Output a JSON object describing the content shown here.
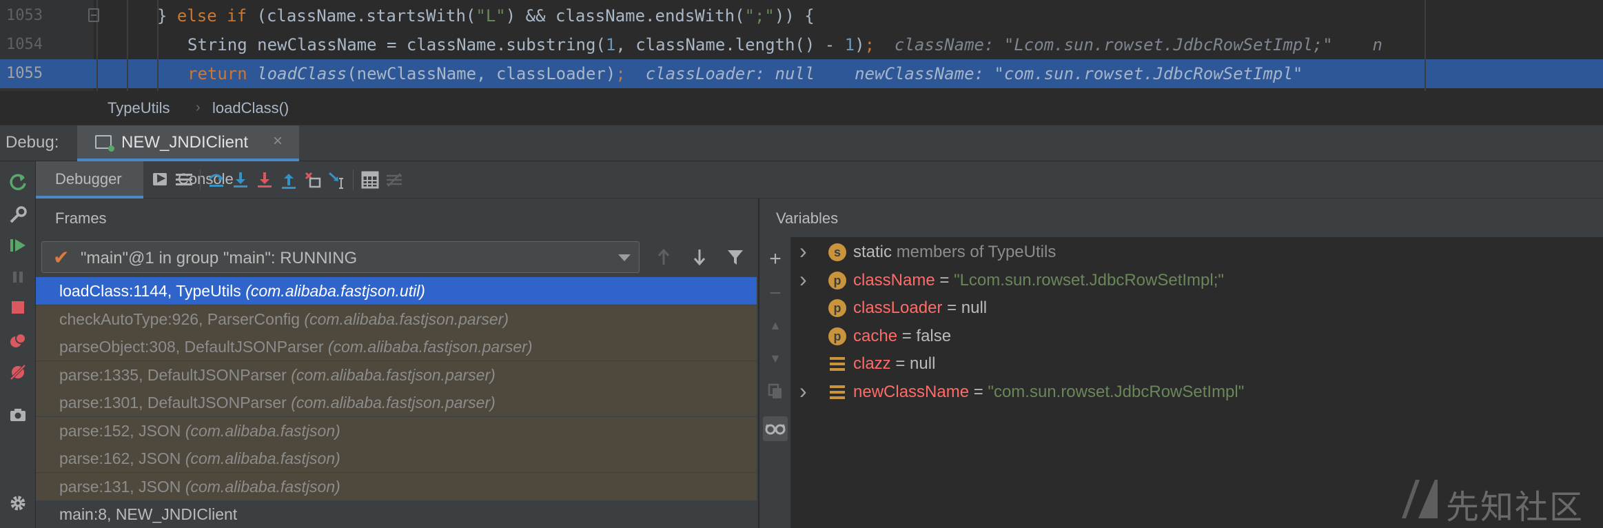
{
  "editor": {
    "lines": [
      {
        "number": "1053",
        "tokens": [
          {
            "t": "} ",
            "c": ""
          },
          {
            "t": "else if ",
            "c": "kw"
          },
          {
            "t": "(className.startsWith(",
            "c": ""
          },
          {
            "t": "\"L\"",
            "c": "str"
          },
          {
            "t": ") && className.endsWith(",
            "c": ""
          },
          {
            "t": "\";\"",
            "c": "str"
          },
          {
            "t": ")) {",
            "c": ""
          }
        ]
      },
      {
        "number": "1054",
        "tokens": [
          {
            "t": "String newClassName = className.substring(",
            "c": ""
          },
          {
            "t": "1",
            "c": "num"
          },
          {
            "t": ", className.length() - ",
            "c": ""
          },
          {
            "t": "1",
            "c": "num"
          },
          {
            "t": ")",
            "c": ""
          },
          {
            "t": ";",
            "c": "kw"
          },
          {
            "t": "  className: \"Lcom.sun.rowset.JdbcRowSetImpl;\"    n",
            "c": "inlay"
          }
        ]
      },
      {
        "number": "1055",
        "tokens": [
          {
            "t": "return ",
            "c": "kw"
          },
          {
            "t": "loadClass",
            "c": "it"
          },
          {
            "t": "(newClassName, classLoader)",
            "c": ""
          },
          {
            "t": ";",
            "c": "kw"
          },
          {
            "t": "  classLoader: null    newClassName: \"com.sun.rowset.JdbcRowSetImpl\"",
            "c": "inlay"
          }
        ]
      }
    ]
  },
  "breadcrumb": {
    "items": [
      "TypeUtils",
      "loadClass()"
    ],
    "separator": "›"
  },
  "debug_bar": {
    "label": "Debug:",
    "session_tab": "NEW_JNDIClient",
    "close_glyph": "×"
  },
  "tabs": {
    "debugger": "Debugger",
    "console": "Console"
  },
  "frames": {
    "header": "Frames",
    "thread": "\"main\"@1 in group \"main\": RUNNING",
    "rows": [
      {
        "method": "loadClass:1144, TypeUtils ",
        "pkg": "(com.alibaba.fastjson.util)",
        "style": "selected"
      },
      {
        "method": "checkAutoType:926, ParserConfig ",
        "pkg": "(com.alibaba.fastjson.parser)",
        "style": "library"
      },
      {
        "method": "parseObject:308, DefaultJSONParser ",
        "pkg": "(com.alibaba.fastjson.parser)",
        "style": "library"
      },
      {
        "method": "parse:1335, DefaultJSONParser ",
        "pkg": "(com.alibaba.fastjson.parser)",
        "style": "library"
      },
      {
        "method": "parse:1301, DefaultJSONParser ",
        "pkg": "(com.alibaba.fastjson.parser)",
        "style": "library"
      },
      {
        "method": "parse:152, JSON ",
        "pkg": "(com.alibaba.fastjson)",
        "style": "library"
      },
      {
        "method": "parse:162, JSON ",
        "pkg": "(com.alibaba.fastjson)",
        "style": "library"
      },
      {
        "method": "parse:131, JSON ",
        "pkg": "(com.alibaba.fastjson)",
        "style": "library"
      },
      {
        "method": "main:8, NEW_JNDIClient",
        "pkg": "",
        "style": "normal"
      }
    ]
  },
  "variables": {
    "header": "Variables",
    "rows": [
      {
        "expand": true,
        "icon": "s",
        "name": "static",
        "eq": "",
        "value": "members of TypeUtils",
        "kind": "static"
      },
      {
        "expand": true,
        "icon": "p",
        "name": "className",
        "eq": " = ",
        "value": "\"Lcom.sun.rowset.JdbcRowSetImpl;\"",
        "kind": "str"
      },
      {
        "expand": false,
        "icon": "p",
        "name": "classLoader",
        "eq": " = ",
        "value": "null",
        "kind": "plain"
      },
      {
        "expand": false,
        "icon": "p",
        "name": "cache",
        "eq": " = ",
        "value": "false",
        "kind": "plain"
      },
      {
        "expand": false,
        "icon": "field",
        "name": "clazz",
        "eq": " = ",
        "value": "null",
        "kind": "plain"
      },
      {
        "expand": true,
        "icon": "field",
        "name": "newClassName",
        "eq": " = ",
        "value": "\"com.sun.rowset.JdbcRowSetImpl\"",
        "kind": "str"
      }
    ]
  },
  "watermark": {
    "text": "先知社区"
  },
  "colors": {
    "accent": "#4a88c7",
    "selection": "#2f65ca",
    "current_line": "#2d5797",
    "library_frame": "#4f493d",
    "string": "#6a8759",
    "keyword": "#cc7832",
    "var_name": "#ff6b68"
  }
}
